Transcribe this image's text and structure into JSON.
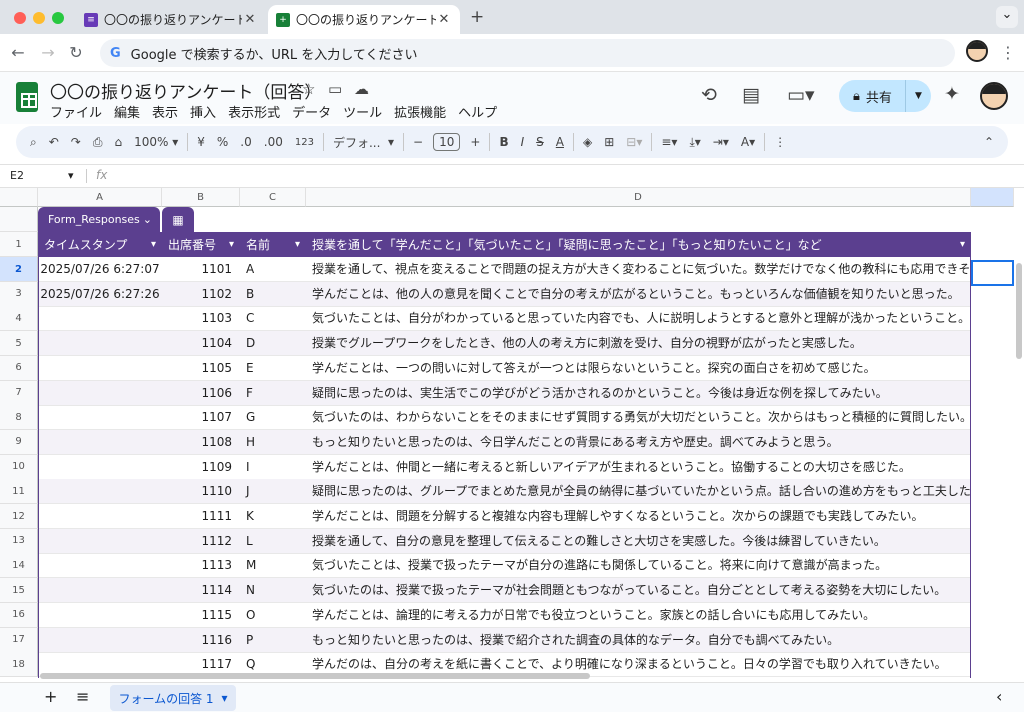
{
  "browser": {
    "tabs": [
      {
        "title": "〇〇の振り返りアンケート - Goo",
        "close": "✕",
        "active": false
      },
      {
        "title": "〇〇の振り返りアンケート（回答",
        "close": "✕",
        "active": true
      }
    ],
    "new_tab": "+",
    "address_placeholder": "Google で検索するか、URL を入力してください",
    "address_g": "G",
    "menu_icon": "⌄"
  },
  "app": {
    "title": "〇〇の振り返りアンケート（回答）",
    "menus": [
      "ファイル",
      "編集",
      "表示",
      "挿入",
      "表示形式",
      "データ",
      "ツール",
      "拡張機能",
      "ヘルプ"
    ],
    "share_label": "共有"
  },
  "toolbar": {
    "zoom": "100%",
    "currency": "¥",
    "percent": "%",
    "dec_decrease": ".0",
    "dec_increase": ".00",
    "number_format": "123",
    "font": "デフォ...",
    "font_size": "10"
  },
  "formula_bar": {
    "cell_ref": "E2",
    "fx": "fx",
    "value": ""
  },
  "columns": [
    "A",
    "B",
    "C",
    "D"
  ],
  "table": {
    "name": "Form_Responses",
    "headers": [
      "タイムスタンプ",
      "出席番号",
      "名前",
      "授業を通して「学んだこと」「気づいたこと」「疑問に思ったこと」「もっと知りたいこと」など"
    ],
    "rows": [
      {
        "n": "2",
        "ts": "2025/07/26 6:27:07",
        "id": "1101",
        "name": "A",
        "text": "授業を通して、視点を変えることで問題の捉え方が大きく変わることに気づいた。数学だけでなく他の教科にも応用できそうだと感じ"
      },
      {
        "n": "3",
        "ts": "2025/07/26 6:27:26",
        "id": "1102",
        "name": "B",
        "text": "学んだことは、他の人の意見を聞くことで自分の考えが広がるということ。もっといろんな価値観を知りたいと思った。"
      },
      {
        "n": "4",
        "ts": "",
        "id": "1103",
        "name": "C",
        "text": "気づいたことは、自分がわかっていると思っていた内容でも、人に説明しようとすると意外と理解が浅かったということ。もっと深く"
      },
      {
        "n": "5",
        "ts": "",
        "id": "1104",
        "name": "D",
        "text": "授業でグループワークをしたとき、他の人の考え方に刺激を受け、自分の視野が広がったと実感した。"
      },
      {
        "n": "6",
        "ts": "",
        "id": "1105",
        "name": "E",
        "text": "学んだことは、一つの問いに対して答えが一つとは限らないということ。探究の面白さを初めて感じた。"
      },
      {
        "n": "7",
        "ts": "",
        "id": "1106",
        "name": "F",
        "text": "疑問に思ったのは、実生活でこの学びがどう活かされるのかということ。今後は身近な例を探してみたい。"
      },
      {
        "n": "8",
        "ts": "",
        "id": "1107",
        "name": "G",
        "text": "気づいたのは、わからないことをそのままにせず質問する勇気が大切だということ。次からはもっと積極的に質問したい。"
      },
      {
        "n": "9",
        "ts": "",
        "id": "1108",
        "name": "H",
        "text": "もっと知りたいと思ったのは、今日学んだことの背景にある考え方や歴史。調べてみようと思う。"
      },
      {
        "n": "10",
        "ts": "",
        "id": "1109",
        "name": "I",
        "text": "学んだことは、仲間と一緒に考えると新しいアイデアが生まれるということ。協働することの大切さを感じた。"
      },
      {
        "n": "11",
        "ts": "",
        "id": "1110",
        "name": "J",
        "text": "疑問に思ったのは、グループでまとめた意見が全員の納得に基づいていたかという点。話し合いの進め方をもっと工夫したい。"
      },
      {
        "n": "12",
        "ts": "",
        "id": "1111",
        "name": "K",
        "text": "学んだことは、問題を分解すると複雑な内容も理解しやすくなるということ。次からの課題でも実践してみたい。"
      },
      {
        "n": "13",
        "ts": "",
        "id": "1112",
        "name": "L",
        "text": "授業を通して、自分の意見を整理して伝えることの難しさと大切さを実感した。今後は練習していきたい。"
      },
      {
        "n": "14",
        "ts": "",
        "id": "1113",
        "name": "M",
        "text": "気づいたことは、授業で扱ったテーマが自分の進路にも関係していること。将来に向けて意識が高まった。"
      },
      {
        "n": "15",
        "ts": "",
        "id": "1114",
        "name": "N",
        "text": "気づいたのは、授業で扱ったテーマが社会問題ともつながっていること。自分ごととして考える姿勢を大切にしたい。"
      },
      {
        "n": "16",
        "ts": "",
        "id": "1115",
        "name": "O",
        "text": "学んだことは、論理的に考える力が日常でも役立つということ。家族との話し合いにも応用してみたい。"
      },
      {
        "n": "17",
        "ts": "",
        "id": "1116",
        "name": "P",
        "text": "もっと知りたいと思ったのは、授業で紹介された調査の具体的なデータ。自分でも調べてみたい。"
      },
      {
        "n": "18",
        "ts": "",
        "id": "1117",
        "name": "Q",
        "text": "学んだのは、自分の考えを紙に書くことで、より明確になり深まるということ。日々の学習でも取り入れていきたい。"
      }
    ]
  },
  "bottom": {
    "add": "+",
    "list": "≡",
    "sheet_tab": "フォームの回答 1",
    "collapse": "‹"
  },
  "colors": {
    "table_header": "#5b3f8f",
    "share_bg": "#c2e7ff",
    "selection": "#1a73e8"
  }
}
